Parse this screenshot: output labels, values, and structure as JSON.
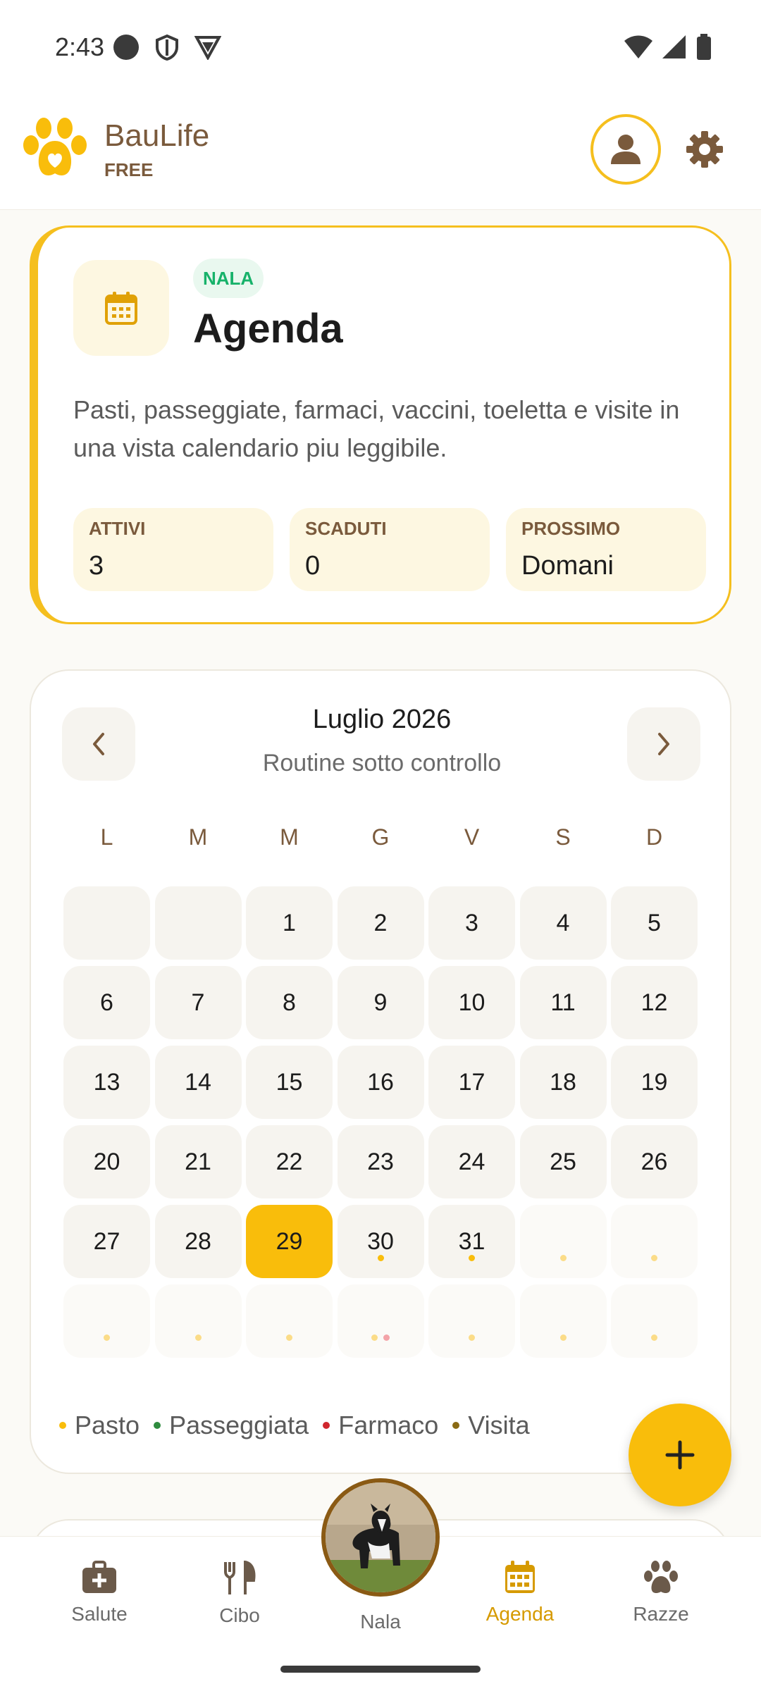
{
  "status_bar": {
    "time": "2:43"
  },
  "header": {
    "brand": "BauLife",
    "plan": "FREE"
  },
  "hero": {
    "pet_tag": "NALA",
    "title": "Agenda",
    "description": "Pasti, passeggiate, farmaci, vaccini, toeletta e visite in una vista calendario piu leggibile.",
    "stats": [
      {
        "label": "ATTIVI",
        "value": "3"
      },
      {
        "label": "SCADUTI",
        "value": "0"
      },
      {
        "label": "PROSSIMO",
        "value": "Domani"
      }
    ]
  },
  "calendar": {
    "month": "Luglio 2026",
    "subtitle": "Routine sotto controllo",
    "weekdays": [
      "L",
      "M",
      "M",
      "G",
      "V",
      "S",
      "D"
    ],
    "today": "29",
    "days": [
      {
        "label": "",
        "faded": false
      },
      {
        "label": "",
        "faded": false
      },
      {
        "label": "1"
      },
      {
        "label": "2"
      },
      {
        "label": "3"
      },
      {
        "label": "4"
      },
      {
        "label": "5"
      },
      {
        "label": "6"
      },
      {
        "label": "7"
      },
      {
        "label": "8"
      },
      {
        "label": "9"
      },
      {
        "label": "10"
      },
      {
        "label": "11"
      },
      {
        "label": "12"
      },
      {
        "label": "13"
      },
      {
        "label": "14"
      },
      {
        "label": "15"
      },
      {
        "label": "16"
      },
      {
        "label": "17"
      },
      {
        "label": "18"
      },
      {
        "label": "19"
      },
      {
        "label": "20"
      },
      {
        "label": "21"
      },
      {
        "label": "22"
      },
      {
        "label": "23"
      },
      {
        "label": "24"
      },
      {
        "label": "25"
      },
      {
        "label": "26"
      },
      {
        "label": "27"
      },
      {
        "label": "28"
      },
      {
        "label": "29",
        "today": true
      },
      {
        "label": "30",
        "dots": [
          "pasto"
        ]
      },
      {
        "label": "31",
        "dots": [
          "pasto"
        ]
      },
      {
        "label": "",
        "faded": true,
        "dots": [
          "pasto-light"
        ]
      },
      {
        "label": "",
        "faded": true,
        "dots": [
          "pasto-light"
        ]
      },
      {
        "label": "",
        "faded": true,
        "dots": [
          "pasto-light"
        ]
      },
      {
        "label": "",
        "faded": true,
        "dots": [
          "pasto-light"
        ]
      },
      {
        "label": "",
        "faded": true,
        "dots": [
          "pasto-light"
        ]
      },
      {
        "label": "",
        "faded": true,
        "dots": [
          "pasto-light",
          "farmaco-light"
        ]
      },
      {
        "label": "",
        "faded": true,
        "dots": [
          "pasto-light"
        ]
      },
      {
        "label": "",
        "faded": true,
        "dots": [
          "pasto-light"
        ]
      },
      {
        "label": "",
        "faded": true,
        "dots": [
          "pasto-light"
        ]
      }
    ],
    "legend": [
      {
        "label": "Pasto",
        "color": "#f9bd0b"
      },
      {
        "label": "Passeggiata",
        "color": "#2e8b3e"
      },
      {
        "label": "Farmaco",
        "color": "#d0262e"
      },
      {
        "label": "Visita",
        "color": "#8a6a14"
      }
    ],
    "dot_colors": {
      "pasto": "#f9bd0b",
      "pasto-light": "#fbdc88",
      "farmaco-light": "#f3a3a8"
    }
  },
  "bottom_nav": {
    "items": [
      {
        "label": "Salute",
        "icon": "medkit-icon"
      },
      {
        "label": "Cibo",
        "icon": "utensils-icon"
      },
      {
        "label": "Agenda",
        "icon": "calendar-icon",
        "active": true
      },
      {
        "label": "Razze",
        "icon": "paw-icon"
      }
    ],
    "center_label": "Nala"
  },
  "colors": {
    "accent": "#f9bd0b",
    "brand_brown": "#7a5a3c",
    "active_nav": "#d69a00"
  }
}
